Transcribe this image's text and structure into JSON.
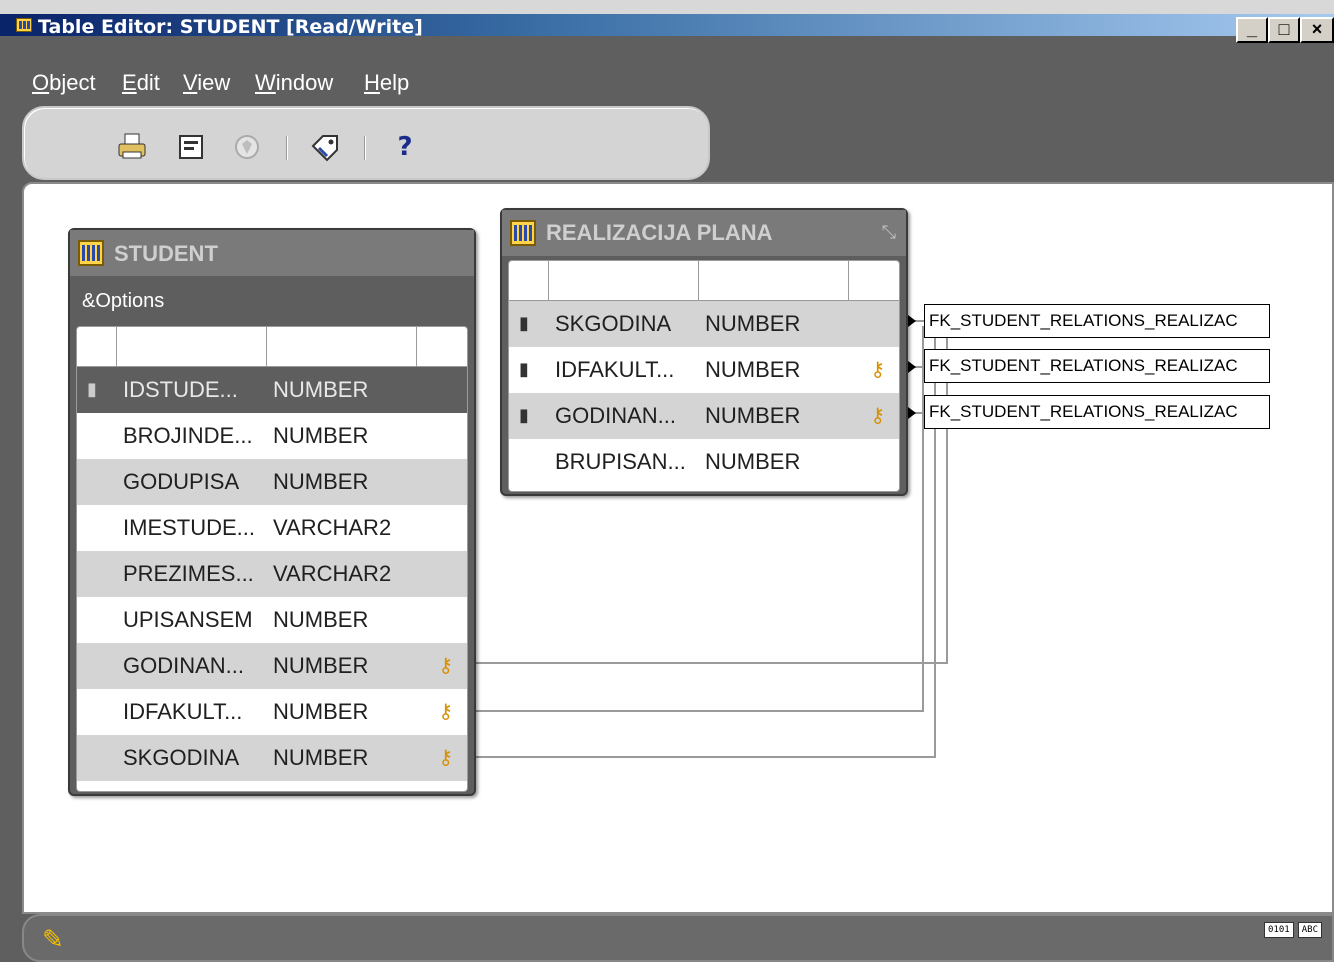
{
  "window": {
    "title": "Table Editor: STUDENT [Read/Write]",
    "minimize_label": "_",
    "maximize_label": "□",
    "close_label": "×"
  },
  "menu": {
    "items": [
      {
        "label": "Object",
        "mnemonic": "O"
      },
      {
        "label": "Edit",
        "mnemonic": "E"
      },
      {
        "label": "View",
        "mnemonic": "V"
      },
      {
        "label": "Window",
        "mnemonic": "W"
      },
      {
        "label": "Help",
        "mnemonic": "H"
      }
    ]
  },
  "toolbar": {
    "icons": [
      "print-icon",
      "properties-icon",
      "disabled-icon",
      "tag-icon",
      "help-icon"
    ],
    "help_glyph": "?"
  },
  "student_table": {
    "title": "STUDENT",
    "options_label": "&Options",
    "rows": [
      {
        "name": "IDSTUDE...",
        "type": "NUMBER",
        "pk": true,
        "fk": false
      },
      {
        "name": "BROJINDE...",
        "type": "NUMBER",
        "pk": false,
        "fk": false
      },
      {
        "name": "GODUPISA",
        "type": "NUMBER",
        "pk": false,
        "fk": false
      },
      {
        "name": "IMESTUDE...",
        "type": "VARCHAR2",
        "pk": false,
        "fk": false
      },
      {
        "name": "PREZIMES...",
        "type": "VARCHAR2",
        "pk": false,
        "fk": false
      },
      {
        "name": "UPISANSEM",
        "type": "NUMBER",
        "pk": false,
        "fk": false
      },
      {
        "name": "GODINAN...",
        "type": "NUMBER",
        "pk": false,
        "fk": true
      },
      {
        "name": "IDFAKULT...",
        "type": "NUMBER",
        "pk": false,
        "fk": true
      },
      {
        "name": "SKGODINA",
        "type": "NUMBER",
        "pk": false,
        "fk": true
      }
    ]
  },
  "realizacija_table": {
    "title": "REALIZACIJA PLANA",
    "rows": [
      {
        "name": "SKGODINA",
        "type": "NUMBER",
        "pk": true,
        "fk": false
      },
      {
        "name": "IDFAKULT...",
        "type": "NUMBER",
        "pk": true,
        "fk": true
      },
      {
        "name": "GODINAN...",
        "type": "NUMBER",
        "pk": true,
        "fk": true
      },
      {
        "name": "BRUPISAN...",
        "type": "NUMBER",
        "pk": false,
        "fk": false
      }
    ]
  },
  "fk_labels": [
    "FK_STUDENT_RELATIONS_REALIZAC",
    "FK_STUDENT_RELATIONS_REALIZAC",
    "FK_STUDENT_RELATIONS_REALIZAC"
  ],
  "statusbar": {
    "right_chips": [
      "0101",
      "ABC"
    ]
  },
  "colors": {
    "title_bar": "#0a246a",
    "frame": "#5f5f5f",
    "fk_key": "#d99000",
    "entity_header": "#7a7a7a"
  }
}
